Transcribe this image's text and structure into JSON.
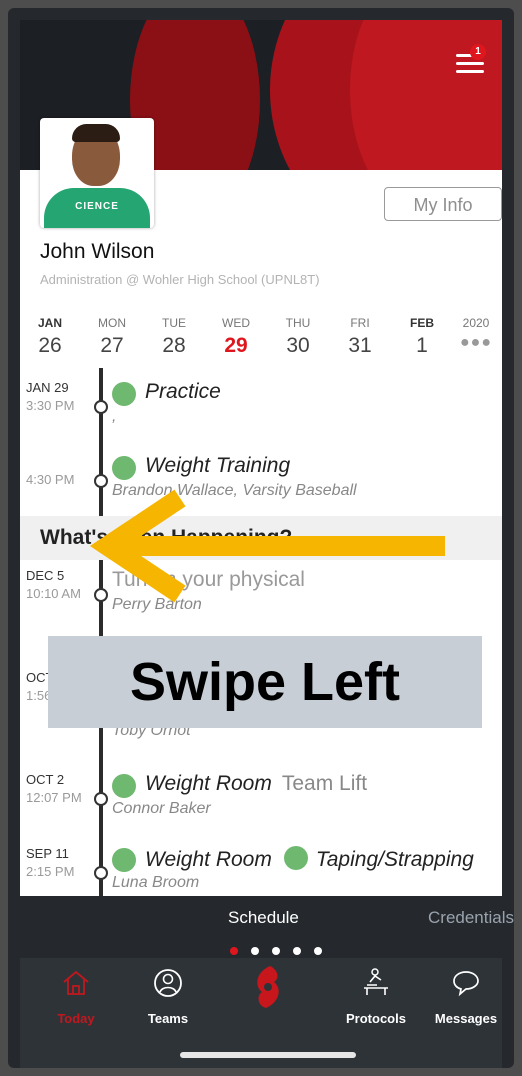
{
  "profile": {
    "name": "John Wilson",
    "subtitle": "Administration @ Wohler High School (UPNL8T)",
    "my_info_label": "My Info",
    "shirt_text": "CIENCE",
    "menu_badge": "1"
  },
  "calendar": [
    {
      "dow": "JAN",
      "num": "26",
      "month": true
    },
    {
      "dow": "MON",
      "num": "27"
    },
    {
      "dow": "TUE",
      "num": "28"
    },
    {
      "dow": "WED",
      "num": "29",
      "today": true
    },
    {
      "dow": "THU",
      "num": "30"
    },
    {
      "dow": "FRI",
      "num": "31"
    },
    {
      "dow": "FEB",
      "num": "1",
      "month": true
    },
    {
      "dow": "2020",
      "num": "●●●"
    }
  ],
  "events": [
    {
      "date": "JAN 29",
      "time": "3:30 PM",
      "title": "Practice",
      "extra": "",
      "sub": ","
    },
    {
      "date": "",
      "time": "4:30 PM",
      "title": "Weight Training",
      "extra": "",
      "sub": "Brandon Wallace, Varsity Baseball"
    },
    {
      "date": "DEC 5",
      "time": "10:10 AM",
      "title": "Turn in your physical",
      "extra": "",
      "sub": "Perry Barton"
    },
    {
      "date": "OCT",
      "time": "1:56",
      "title": "",
      "extra": "",
      "sub": "Toby Ornot"
    },
    {
      "date": "OCT 2",
      "time": "12:07 PM",
      "title": "Weight Room",
      "extra": "Team Lift",
      "sub": "Connor Baker"
    },
    {
      "date": "SEP 11",
      "time": "2:15 PM",
      "title": "Weight Room",
      "extra": "Taping/Strapping",
      "sub": "Luna Broom"
    }
  ],
  "section_title": "What's Been Happening?",
  "overlay": {
    "swipe_text": "Swipe Left",
    "arrow_color": "#f5b500"
  },
  "subbar": {
    "tab_active": "Schedule",
    "tab_next": "Credentials",
    "pages": 5,
    "active_page": 1
  },
  "navbar": [
    {
      "label": "Today",
      "icon": "home-icon",
      "active": true
    },
    {
      "label": "Teams",
      "icon": "user-circle-icon"
    },
    {
      "label": "",
      "icon": "hurricane-logo-icon"
    },
    {
      "label": "Protocols",
      "icon": "massage-table-icon"
    },
    {
      "label": "Messages",
      "icon": "chat-bubble-icon"
    }
  ],
  "colors": {
    "accent": "#e0161e",
    "dark": "#25292e",
    "overlay_box": "#c8ced6"
  }
}
